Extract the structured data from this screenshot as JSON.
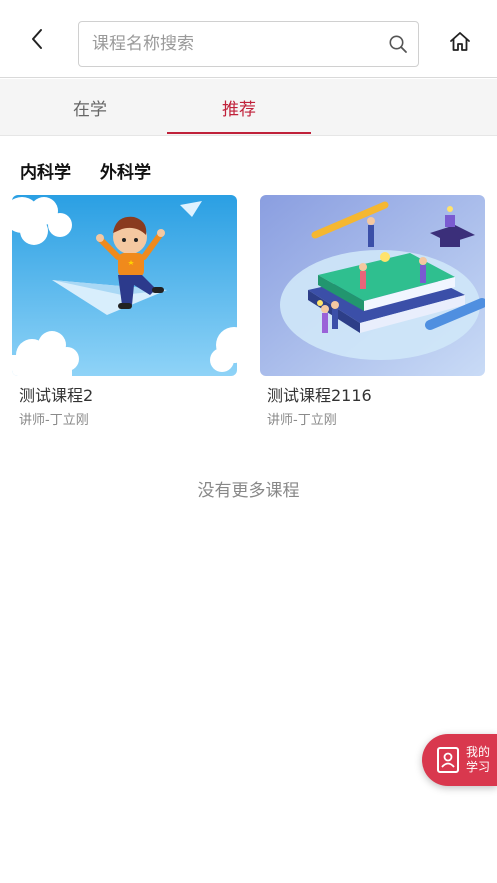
{
  "header": {
    "back_icon": "chevron-left-icon",
    "search_placeholder": "课程名称搜索",
    "search_value": "",
    "search_icon": "search-icon",
    "home_icon": "home-icon"
  },
  "tabs": [
    {
      "label": "在学",
      "active": false
    },
    {
      "label": "推荐",
      "active": true
    }
  ],
  "categories": [
    {
      "label": "内科学"
    },
    {
      "label": "外科学"
    }
  ],
  "courses": [
    {
      "title": "测试课程2",
      "teacher": "讲师-丁立刚"
    },
    {
      "title": "测试课程2116",
      "teacher": "讲师-丁立刚"
    }
  ],
  "footer_text": "没有更多课程",
  "floating_button": {
    "line1": "我的",
    "line2": "学习",
    "icon": "id-badge-icon"
  },
  "colors": {
    "accent": "#c0213a",
    "float_button": "#d9384e",
    "tab_bg": "#f5f5f5"
  }
}
